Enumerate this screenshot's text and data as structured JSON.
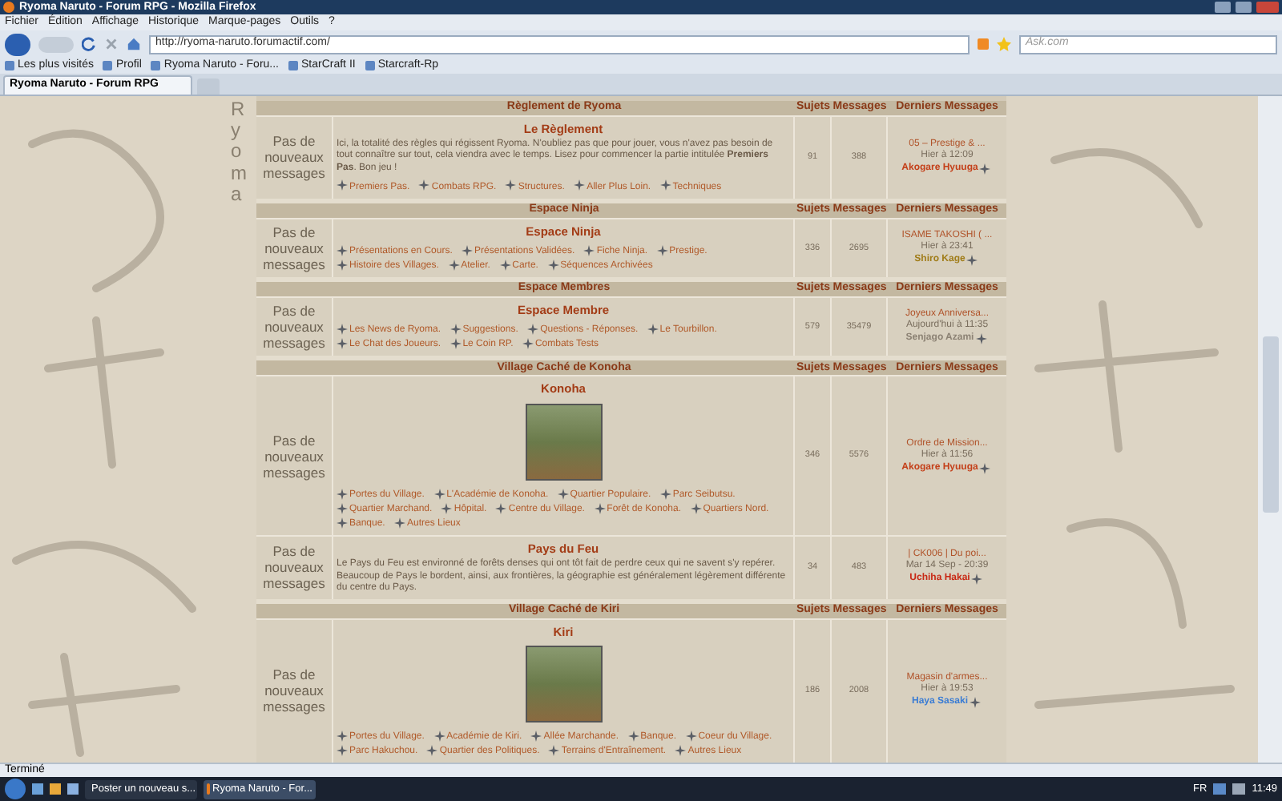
{
  "window": {
    "title": "Ryoma Naruto - Forum RPG - Mozilla Firefox"
  },
  "menu": [
    "Fichier",
    "Édition",
    "Affichage",
    "Historique",
    "Marque-pages",
    "Outils",
    "?"
  ],
  "address": {
    "value": "http://ryoma-naruto.forumactif.com/"
  },
  "search": {
    "placeholder": "Ask.com"
  },
  "bookmarks": [
    "Les plus visités",
    "Profil",
    "Ryoma Naruto - Foru...",
    "StarCraft II",
    "Starcraft-Rp"
  ],
  "tabs": [
    {
      "label": "Ryoma Naruto - Forum RPG",
      "selected": true
    }
  ],
  "banner": "Ryoma",
  "categories": [
    {
      "title": "Règlement de Ryoma",
      "columns": [
        "Sujets",
        "Messages",
        "Derniers Messages"
      ],
      "forums": [
        {
          "status": "Pas de nouveaux messages",
          "name": "Le Règlement",
          "image": false,
          "description": "Ici, la totalité des règles qui régissent Ryoma. N'oubliez pas que pour jouer, vous n'avez pas besoin de tout connaître sur tout, cela viendra avec le temps. Lisez pour commencer la partie intitulée **Premiers Pas**. Bon jeu !",
          "subforums": [
            "Premiers Pas.",
            "Combats RPG.",
            "Structures.",
            "Aller Plus Loin.",
            "Techniques"
          ],
          "topics": "91",
          "posts": "388",
          "last": {
            "title": "05 – Prestige & ...",
            "date": "Hier à 12:09",
            "author": "Akogare Hyuuga",
            "color": "#c4401a"
          }
        }
      ]
    },
    {
      "title": "Espace Ninja",
      "columns": [
        "Sujets",
        "Messages",
        "Derniers Messages"
      ],
      "forums": [
        {
          "status": "Pas de nouveaux messages",
          "name": "Espace Ninja",
          "image": false,
          "subforums": [
            "Présentations en Cours.",
            "Présentations Validées.",
            "Fiche Ninja.",
            "Prestige.",
            "Histoire des Villages.",
            "Atelier.",
            "Carte.",
            "Séquences Archivées"
          ],
          "topics": "336",
          "posts": "2695",
          "last": {
            "title": "ISAME TAKOSHI ( ...",
            "date": "Hier à 23:41",
            "author": "Shiro Kage",
            "color": "#a07c18"
          }
        }
      ]
    },
    {
      "title": "Espace Membres",
      "columns": [
        "Sujets",
        "Messages",
        "Derniers Messages"
      ],
      "forums": [
        {
          "status": "Pas de nouveaux messages",
          "name": "Espace Membre",
          "image": false,
          "subforums": [
            "Les News de Ryoma.",
            "Suggestions.",
            "Questions - Réponses.",
            "Le Tourbillon.",
            "Le Chat des Joueurs.",
            "Le Coin RP.",
            "Combats Tests"
          ],
          "topics": "579",
          "posts": "35479",
          "last": {
            "title": "Joyeux Anniversa...",
            "date": "Aujourd'hui à 11:35",
            "author": "Senjago Azami",
            "color": "#8c8274"
          }
        }
      ]
    },
    {
      "title": "Village Caché de Konoha",
      "columns": [
        "Sujets",
        "Messages",
        "Derniers Messages"
      ],
      "forums": [
        {
          "status": "Pas de nouveaux messages",
          "name": "Konoha",
          "image": true,
          "subforums": [
            "Portes du Village.",
            "L'Académie de Konoha.",
            "Quartier Populaire.",
            "Parc Seibutsu.",
            "Quartier Marchand.",
            "Hôpital.",
            "Centre du Village.",
            "Forêt de Konoha.",
            "Quartiers Nord.",
            "Banque.",
            "Autres Lieux"
          ],
          "topics": "346",
          "posts": "5576",
          "last": {
            "title": "Ordre de Mission...",
            "date": "Hier à 11:56",
            "author": "Akogare Hyuuga",
            "color": "#c4401a"
          }
        },
        {
          "status": "Pas de nouveaux messages",
          "name": "Pays du Feu",
          "image": false,
          "description": "Le Pays du Feu est environné de forêts denses qui ont tôt fait de perdre ceux qui ne savent s'y repérer. Beaucoup de Pays le bordent, ainsi, aux frontières, la géographie est généralement légèrement différente du centre du Pays.",
          "topics": "34",
          "posts": "483",
          "last": {
            "title": "| CK006 | Du poi...",
            "date": "Mar 14 Sep - 20:39",
            "author": "Uchiha Hakai",
            "color": "#c82814"
          }
        }
      ]
    },
    {
      "title": "Village Caché de Kiri",
      "columns": [
        "Sujets",
        "Messages",
        "Derniers Messages"
      ],
      "forums": [
        {
          "status": "Pas de nouveaux messages",
          "name": "Kiri",
          "image": true,
          "subforums": [
            "Portes du Village.",
            "Académie de Kiri.",
            "Allée Marchande.",
            "Banque.",
            "Coeur du Village.",
            "Parc Hakuchou.",
            "Quartier des Politiques.",
            "Terrains d'Entraînement.",
            "Autres Lieux"
          ],
          "topics": "186",
          "posts": "2008",
          "last": {
            "title": "Magasin d'armes...",
            "date": "Hier à 19:53",
            "author": "Haya Sasaki",
            "color": "#3a7cd4"
          }
        }
      ]
    }
  ],
  "status_bar": "Terminé",
  "taskbar": {
    "tasks": [
      {
        "label": "Poster un nouveau s...",
        "selected": false
      },
      {
        "label": "Ryoma Naruto - For...",
        "selected": true
      }
    ],
    "language": "FR",
    "clock": "11:49"
  }
}
